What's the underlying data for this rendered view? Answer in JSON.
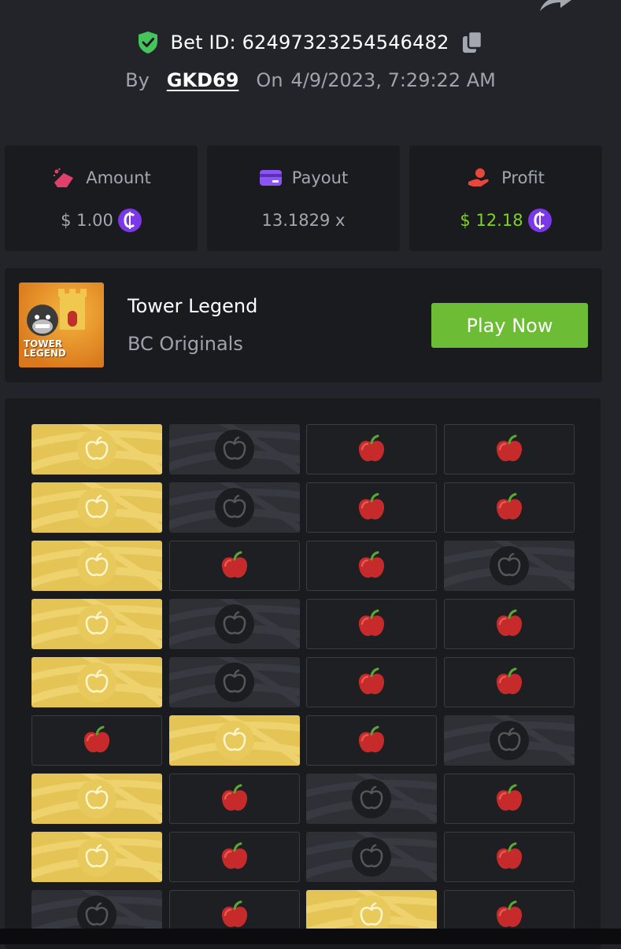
{
  "header": {
    "bet_id": "Bet ID: 6249732325454648​2",
    "by_label": "By",
    "username": "GKD69",
    "on_label": "On",
    "date": "4/9/2023, 7:29:22 AM"
  },
  "stats": {
    "amount": {
      "label": "Amount",
      "value": "$ 1.00"
    },
    "payout": {
      "label": "Payout",
      "value": "13.1829 x"
    },
    "profit": {
      "label": "Profit",
      "value": "$ 12.18"
    }
  },
  "game": {
    "title": "Tower Legend",
    "provider": "BC Originals",
    "play_label": "Play Now",
    "thumb_text_1": "TOWER",
    "thumb_text_2": "LEGEND"
  },
  "board": {
    "rows": [
      [
        "gold",
        "safe",
        "red",
        "red"
      ],
      [
        "gold",
        "safe",
        "red",
        "red"
      ],
      [
        "gold",
        "red",
        "red",
        "safe"
      ],
      [
        "gold",
        "safe",
        "red",
        "red"
      ],
      [
        "gold",
        "safe",
        "red",
        "red"
      ],
      [
        "red",
        "gold",
        "red",
        "safe"
      ],
      [
        "gold",
        "red",
        "safe",
        "red"
      ],
      [
        "gold",
        "red",
        "safe",
        "red"
      ],
      [
        "safe",
        "red",
        "gold",
        "red"
      ]
    ]
  },
  "colors": {
    "background": "#232429",
    "panel": "#1a1b1f",
    "gold_tile": "#e3c454",
    "play_button": "#6cbd35",
    "profit_green": "#7ed321",
    "coin_purple": "#7a38e8"
  }
}
